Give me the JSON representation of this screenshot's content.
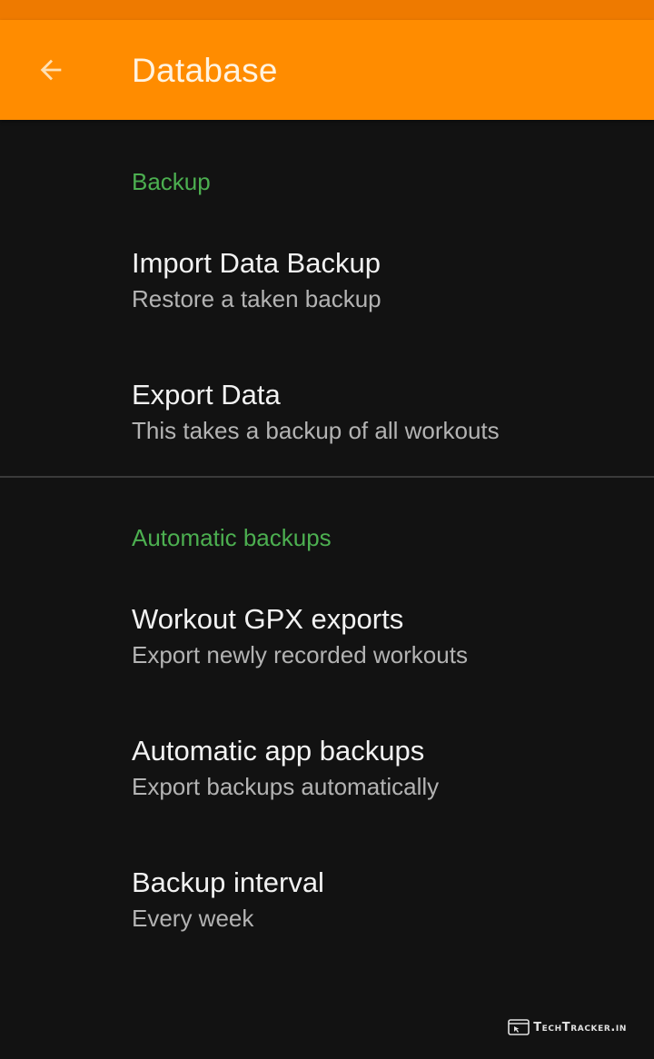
{
  "app_bar": {
    "title": "Database",
    "back_icon": "arrow-back-icon",
    "color": "#FF8C00"
  },
  "sections": [
    {
      "category": "Backup",
      "items": [
        {
          "title": "Import Data Backup",
          "summary": "Restore a taken backup"
        },
        {
          "title": "Export Data",
          "summary": "This takes a backup of all workouts"
        }
      ]
    },
    {
      "category": "Automatic backups",
      "items": [
        {
          "title": "Workout GPX exports",
          "summary": "Export newly recorded workouts"
        },
        {
          "title": "Automatic app backups",
          "summary": "Export backups automatically"
        },
        {
          "title": "Backup interval",
          "summary": "Every week"
        }
      ]
    }
  ],
  "colors": {
    "category": "#4CAF50",
    "background": "#121212"
  },
  "watermark": {
    "text": "TechTracker.in"
  }
}
